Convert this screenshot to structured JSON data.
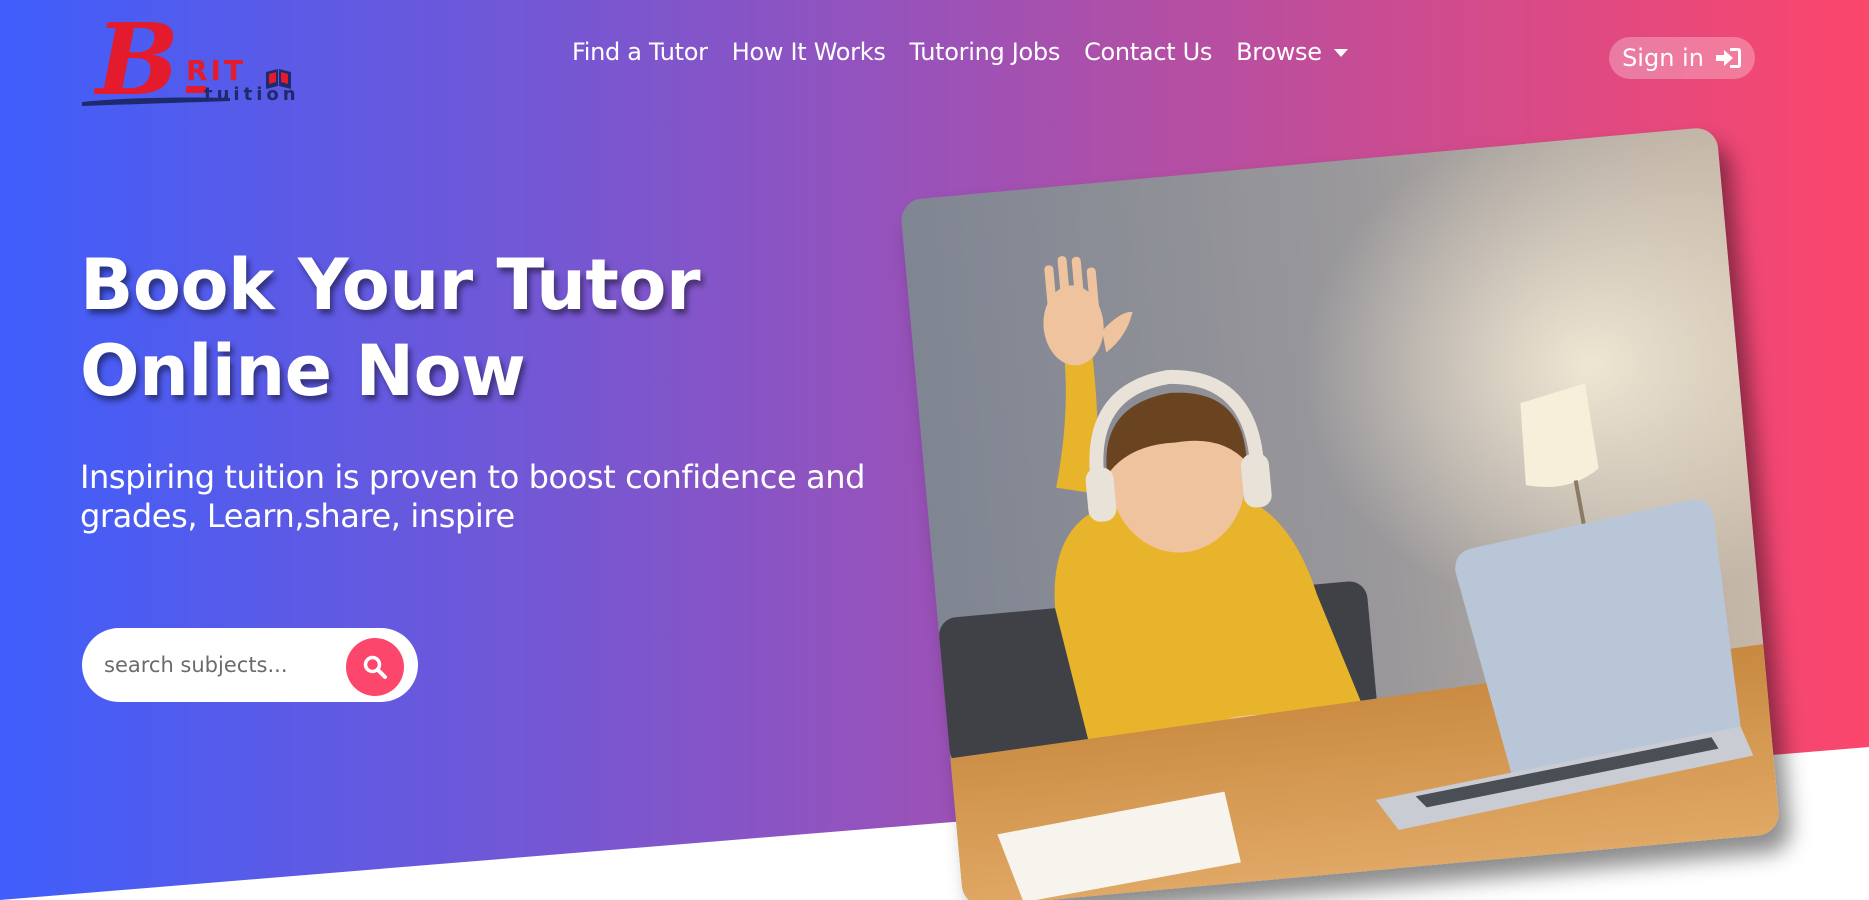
{
  "brand": {
    "name": "BRIT tuition",
    "logo_big_letter": "B",
    "logo_small_letters": "RIT",
    "logo_subtext": "tuition"
  },
  "nav": {
    "items": [
      {
        "label": "Find a Tutor"
      },
      {
        "label": "How It Works"
      },
      {
        "label": "Tutoring Jobs"
      },
      {
        "label": "Contact Us"
      },
      {
        "label": "Browse",
        "has_dropdown": true
      }
    ],
    "signin_label": "Sign in",
    "signin_icon": "sign-in-icon"
  },
  "hero": {
    "headline": "Book Your Tutor Online Now",
    "subtitle": "Inspiring tuition is proven to boost confidence and grades, Learn,share, inspire",
    "search": {
      "placeholder": "search subjects...",
      "value": "",
      "button_icon": "search-icon"
    },
    "image_alt": "Child with headphones raising hand in front of laptop"
  },
  "colors": {
    "gradient_start": "#3f5efb",
    "gradient_mid": "#9a52b8",
    "gradient_end": "#fc466b",
    "accent": "#fc466b",
    "logo_red": "#e31b2c",
    "logo_navy": "#1d2a6b"
  }
}
